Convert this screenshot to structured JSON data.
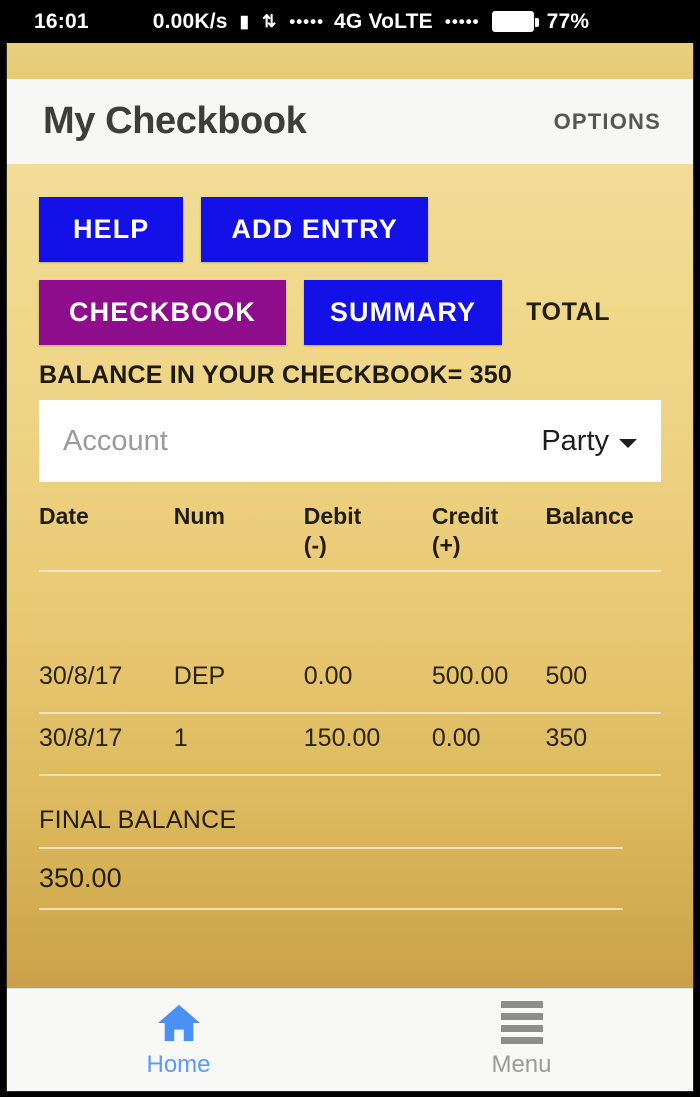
{
  "status_bar": {
    "time": "16:01",
    "network_speed": "0.00K/s",
    "signal_dots_left": "•••••",
    "network_type": "4G VoLTE",
    "signal_dots_right": "•••••",
    "battery_percent": "77%",
    "icons": [
      "signal-bars-icon",
      "data-arrows-icon",
      "battery-icon"
    ]
  },
  "header": {
    "title": "My Checkbook",
    "options_label": "OPTIONS"
  },
  "toolbar": {
    "help_label": "HELP",
    "add_entry_label": "ADD ENTRY",
    "checkbook_label": "CHECKBOOK",
    "summary_label": "SUMMARY",
    "total_label": "TOTAL",
    "active_tab": "CHECKBOOK",
    "colors": {
      "primary_button": "#1310E8",
      "active_tab": "#8D0D8D",
      "background_top": "#F2DD98",
      "background_bottom": "#C9A04A"
    }
  },
  "balance_line": "BALANCE IN YOUR CHECKBOOK= 350",
  "account_bar": {
    "placeholder": "Account",
    "value": "",
    "party_label": "Party",
    "caret_icon": "chevron-down-icon"
  },
  "table": {
    "headers": {
      "date": "Date",
      "num": "Num",
      "debit": "Debit",
      "debit_sign": "(-)",
      "credit": "Credit",
      "credit_sign": "(+)",
      "balance": "Balance"
    },
    "rows": [
      {
        "date": "30/8/17",
        "num": "DEP",
        "debit": "0.00",
        "credit": "500.00",
        "balance": "500"
      },
      {
        "date": "30/8/17",
        "num": "1",
        "debit": "150.00",
        "credit": "0.00",
        "balance": "350"
      }
    ]
  },
  "final_balance": {
    "label": "FINAL BALANCE",
    "value": "350.00"
  },
  "bottom_nav": {
    "items": [
      {
        "label": "Home",
        "icon": "home-icon",
        "active": true
      },
      {
        "label": "Menu",
        "icon": "hamburger-menu-icon",
        "active": false
      }
    ]
  }
}
